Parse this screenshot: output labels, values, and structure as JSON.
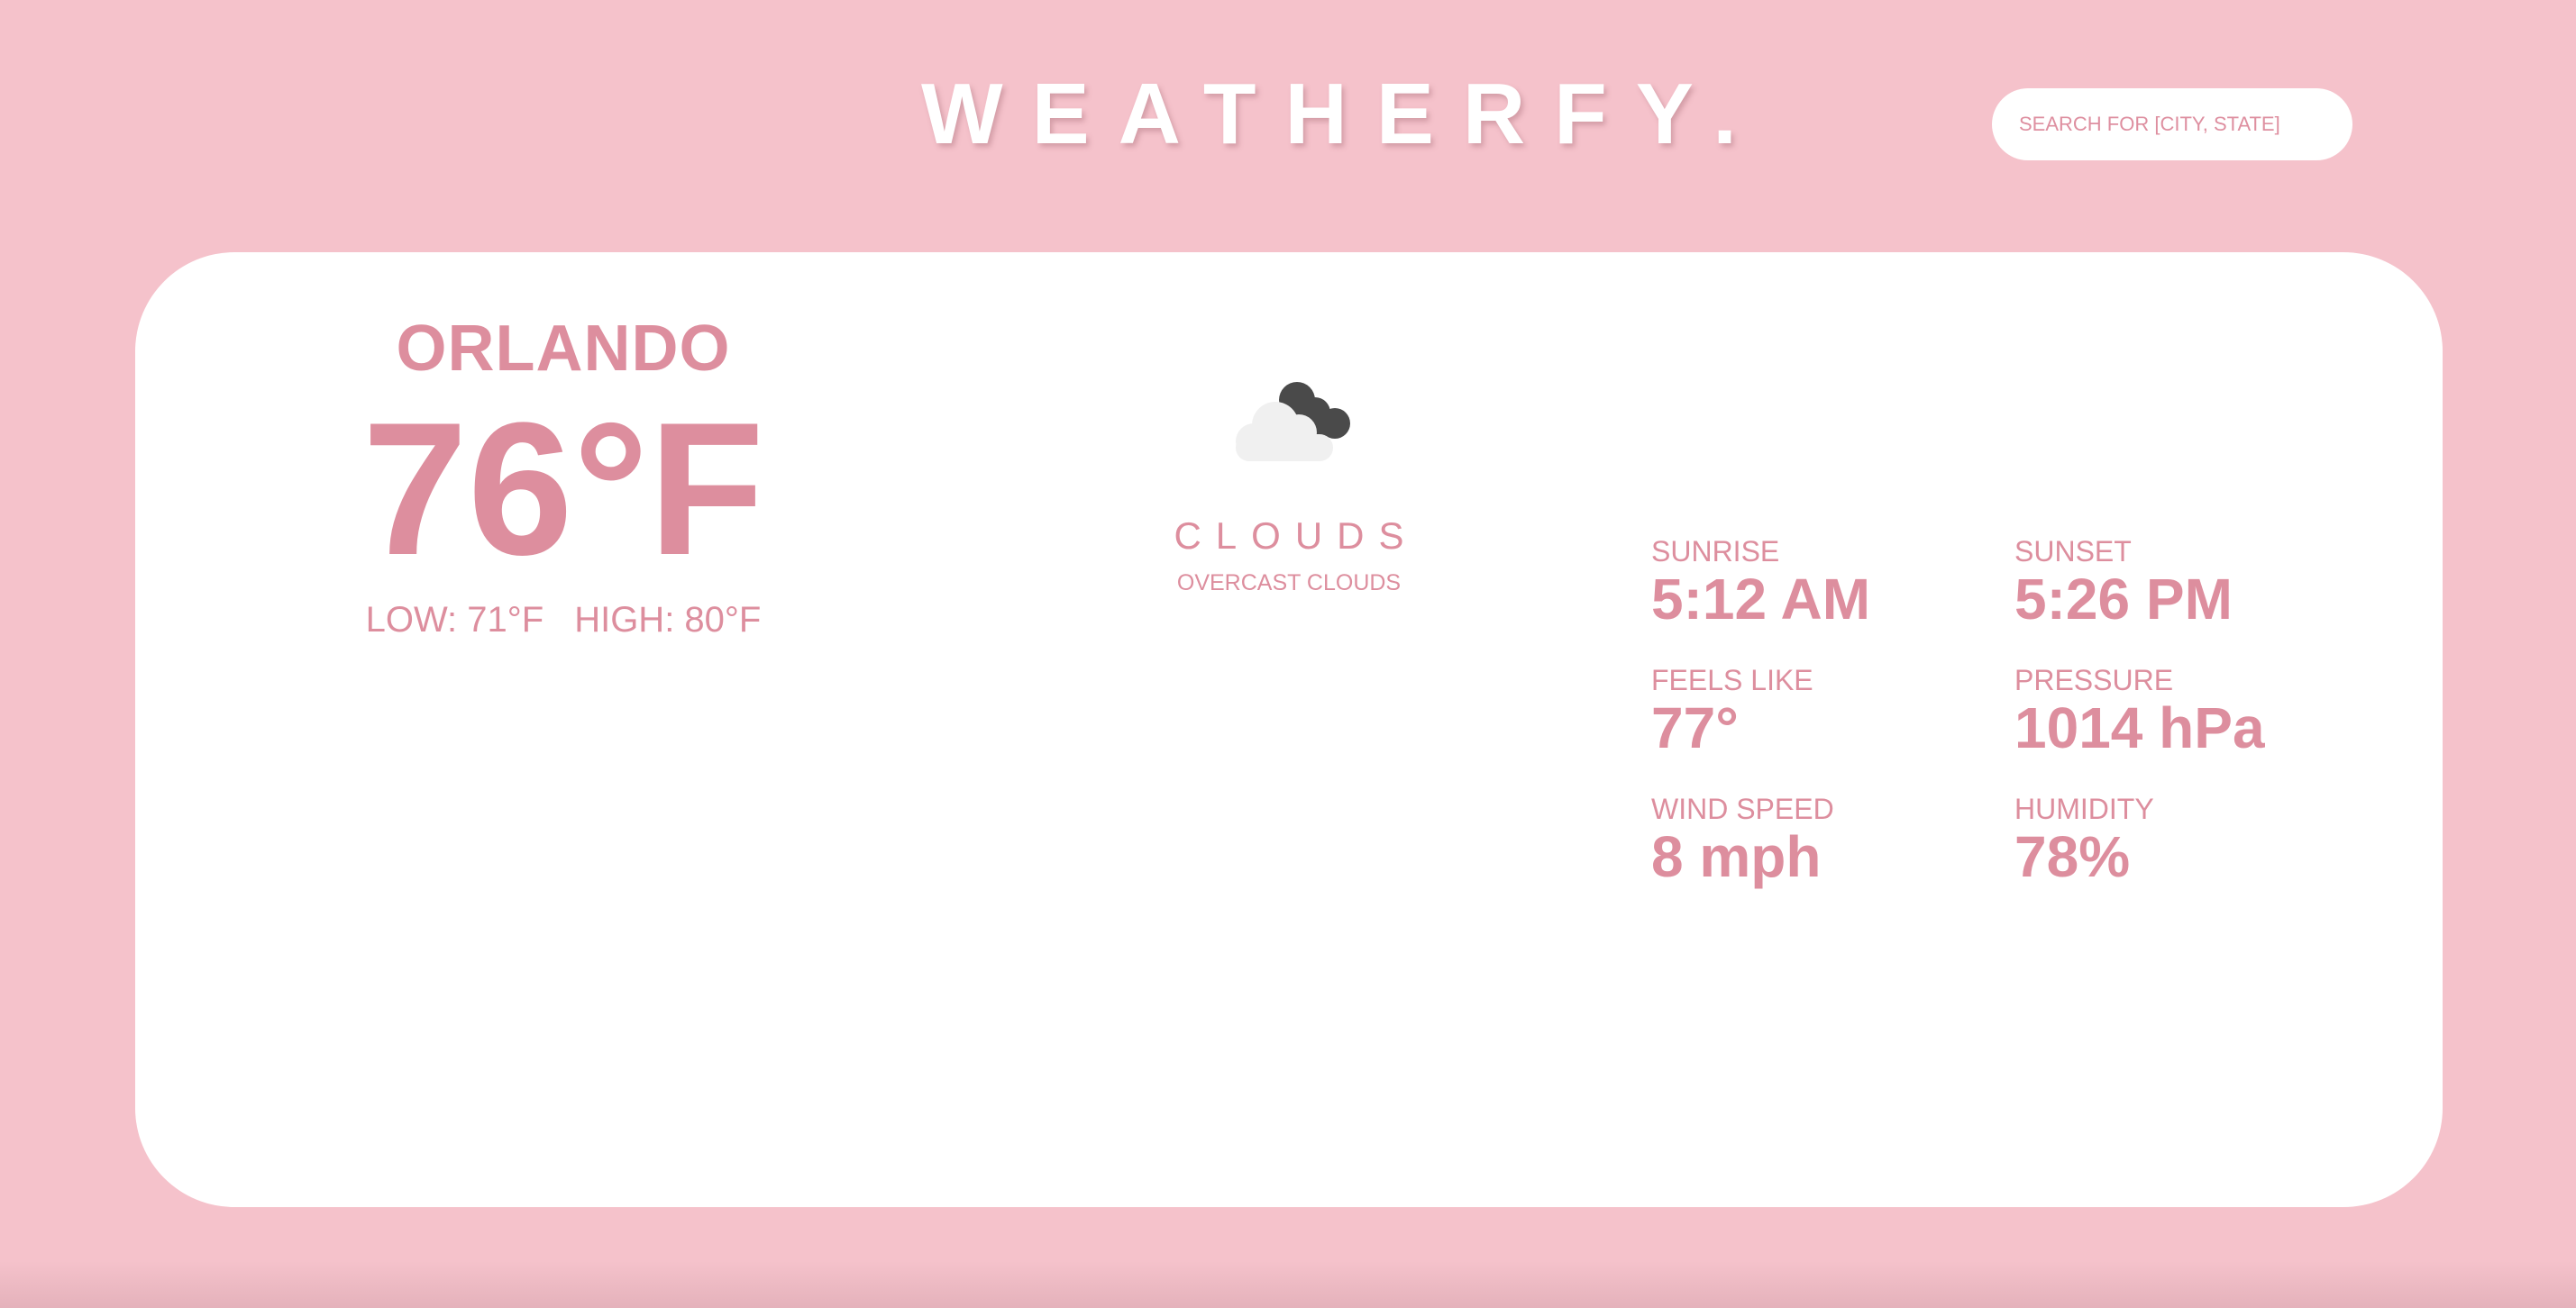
{
  "header": {
    "brand": "WEATHERFY.",
    "search_placeholder": "SEARCH FOR [CITY, STATE]"
  },
  "current": {
    "city": "ORLANDO",
    "temperature": "76°F",
    "low": "LOW: 71°F",
    "high": "HIGH: 80°F"
  },
  "condition": {
    "icon": "clouds-icon",
    "main": "CLOUDS",
    "description": "OVERCAST CLOUDS"
  },
  "stats": {
    "sunrise": {
      "label": "SUNRISE",
      "value": "5:12 AM"
    },
    "sunset": {
      "label": "SUNSET",
      "value": "5:26 PM"
    },
    "feels_like": {
      "label": "FEELS LIKE",
      "value": "77°"
    },
    "pressure": {
      "label": "PRESSURE",
      "value": "1014 hPa"
    },
    "wind_speed": {
      "label": "WIND SPEED",
      "value": "8 mph"
    },
    "humidity": {
      "label": "HUMIDITY",
      "value": "78%"
    }
  },
  "colors": {
    "background": "#f5c2cb",
    "accent": "#dd8e9e",
    "card": "#ffffff"
  }
}
